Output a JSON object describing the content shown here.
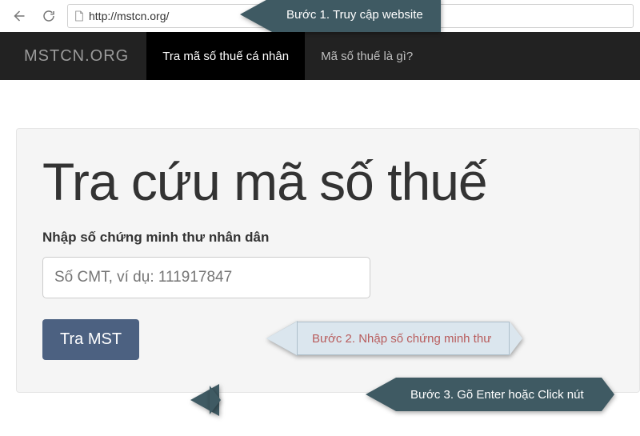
{
  "browser": {
    "url": "http://mstcn.org/"
  },
  "nav": {
    "brand": "MSTCN.ORG",
    "tab1": "Tra mã số thuế cá nhân",
    "tab2": "Mã số thuế là gì?"
  },
  "page": {
    "heading": "Tra cứu mã số thuế",
    "input_label": "Nhập số chứng minh thư nhân dân",
    "input_placeholder": "Số CMT, ví dụ: 111917847",
    "button": "Tra MST"
  },
  "callouts": {
    "step1": "Bước 1. Truy cập website",
    "step2": "Bước 2. Nhập số chứng minh thư",
    "step3": "Bước 3. Gõ Enter hoặc Click nút"
  }
}
